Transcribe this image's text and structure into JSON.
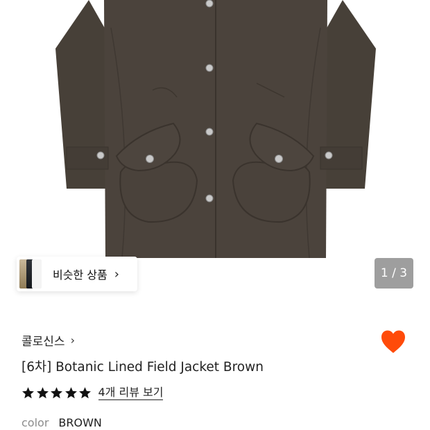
{
  "product_image": {
    "image_alt": "Brown field jacket"
  },
  "similar": {
    "label": "비슷한 상품",
    "chevron": "chevron-right-icon"
  },
  "pager": {
    "text": "1 / 3"
  },
  "brand": {
    "name": "콜로신스",
    "chevron": "chevron-right-icon"
  },
  "wishlist": {
    "icon": "heart-icon",
    "color": "#FF4B0A",
    "active": true
  },
  "product": {
    "title": "[6차] Botanic Lined Field Jacket Brown"
  },
  "rating": {
    "stars": 5,
    "max": 5,
    "reviews_link": "4개 리뷰 보기"
  },
  "option": {
    "label": "color",
    "value": "BROWN"
  },
  "colors": {
    "jacket": "#4b433c",
    "buttons": "#c9c9c9"
  }
}
